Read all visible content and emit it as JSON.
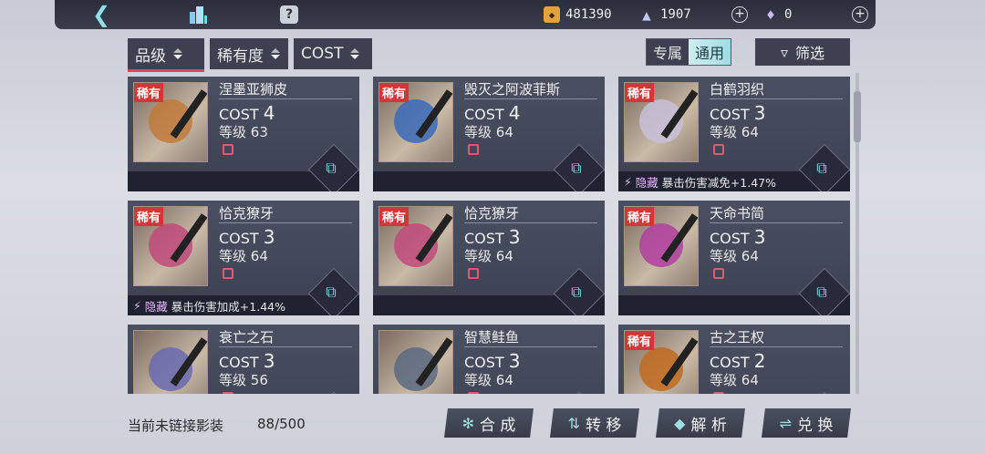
{
  "topbar": {
    "back_icon": "chevron-left-icon",
    "building_icon": "building-icon",
    "help_icon": "question-icon",
    "currency1": {
      "icon": "coin-icon",
      "value": "481390"
    },
    "currency2": {
      "icon": "crystal-icon",
      "value": "1907"
    },
    "currency3": {
      "icon": "diamond-icon",
      "value": "0"
    }
  },
  "filters": {
    "grade": "品级",
    "rarity": "稀有度",
    "cost": "COST"
  },
  "segment": {
    "exclusive": "专属",
    "common": "通用"
  },
  "filter_button": "筛选",
  "cards": [
    {
      "name": "涅墨亚狮皮",
      "rare": "稀有",
      "cost_label": "COST",
      "cost": "4",
      "level_label": "等级",
      "level": "63",
      "bonus_tag": "",
      "bonus": ""
    },
    {
      "name": "毁灭之阿波菲斯",
      "rare": "稀有",
      "cost_label": "COST",
      "cost": "4",
      "level_label": "等级",
      "level": "64",
      "bonus_tag": "",
      "bonus": ""
    },
    {
      "name": "白鹤羽织",
      "rare": "稀有",
      "cost_label": "COST",
      "cost": "3",
      "level_label": "等级",
      "level": "64",
      "bonus_tag": "隐藏",
      "bonus": "暴击伤害减免+1.47%"
    },
    {
      "name": "恰克獠牙",
      "rare": "稀有",
      "cost_label": "COST",
      "cost": "3",
      "level_label": "等级",
      "level": "64",
      "bonus_tag": "隐藏",
      "bonus": "暴击伤害加成+1.44%"
    },
    {
      "name": "恰克獠牙",
      "rare": "稀有",
      "cost_label": "COST",
      "cost": "3",
      "level_label": "等级",
      "level": "64",
      "bonus_tag": "",
      "bonus": ""
    },
    {
      "name": "天命书简",
      "rare": "稀有",
      "cost_label": "COST",
      "cost": "3",
      "level_label": "等级",
      "level": "64",
      "bonus_tag": "",
      "bonus": ""
    },
    {
      "name": "衰亡之石",
      "rare": "",
      "cost_label": "COST",
      "cost": "3",
      "level_label": "等级",
      "level": "56",
      "bonus_tag": "",
      "bonus": ""
    },
    {
      "name": "智慧鲑鱼",
      "rare": "",
      "cost_label": "COST",
      "cost": "3",
      "level_label": "等级",
      "level": "64",
      "bonus_tag": "",
      "bonus": ""
    },
    {
      "name": "古之王权",
      "rare": "稀有",
      "cost_label": "COST",
      "cost": "2",
      "level_label": "等级",
      "level": "64",
      "bonus_tag": "",
      "bonus": ""
    }
  ],
  "footer": {
    "label": "当前未链接影装",
    "count": "88/500",
    "actions": [
      "合 成",
      "转 移",
      "解 析",
      "兑 换"
    ]
  }
}
